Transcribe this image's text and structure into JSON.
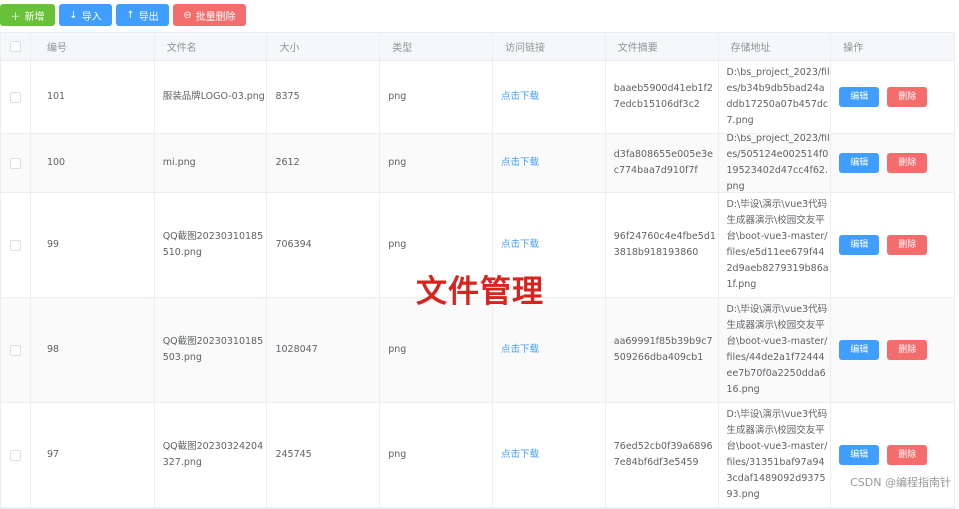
{
  "toolbar": {
    "add_label": "新增",
    "import_label": "导入",
    "export_label": "导出",
    "batch_delete_label": "批量删除"
  },
  "table": {
    "headers": [
      "编号",
      "文件名",
      "大小",
      "类型",
      "访问链接",
      "文件摘要",
      "存储地址",
      "操作"
    ],
    "rows": [
      {
        "id": "101",
        "name": "服装品牌LOGO-03.png",
        "size": "8375",
        "type": "png",
        "link": "点击下载",
        "digest": "baaeb5900d41eb1f27edcb15106df3c2",
        "path": "D:\\bs_project_2023/files/b34b9db5bad24addb17250a07b457dc7.png"
      },
      {
        "id": "100",
        "name": "mi.png",
        "size": "2612",
        "type": "png",
        "link": "点击下载",
        "digest": "d3fa808655e005e3ec774baa7d910f7f",
        "path": "D:\\bs_project_2023/files/505124e002514f019523402d47cc4f62.png"
      },
      {
        "id": "99",
        "name": "QQ截图20230310185510.png",
        "size": "706394",
        "type": "png",
        "link": "点击下载",
        "digest": "96f24760c4e4fbe5d13818b918193860",
        "path": "D:\\毕设\\演示\\vue3代码生成器演示\\校园交友平台\\boot-vue3-master/files/e5d11ee679f442d9aeb8279319b86a1f.png"
      },
      {
        "id": "98",
        "name": "QQ截图20230310185503.png",
        "size": "1028047",
        "type": "png",
        "link": "点击下载",
        "digest": "aa69991f85b39b9c7509266dba409cb1",
        "path": "D:\\毕设\\演示\\vue3代码生成器演示\\校园交友平台\\boot-vue3-master/files/44de2a1f72444ee7b70f0a2250dda616.png"
      },
      {
        "id": "97",
        "name": "QQ截图20230324204327.png",
        "size": "245745",
        "type": "png",
        "link": "点击下载",
        "digest": "76ed52cb0f39a68967e84bf6df3e5459",
        "path": "D:\\毕设\\演示\\vue3代码生成器演示\\校园交友平台\\boot-vue3-master/files/31351baf97a943cdaf1489092d937593.png"
      }
    ],
    "edit_label": "编辑",
    "delete_label": "删除"
  },
  "overlay_title": "文件管理",
  "watermark": "CSDN @编程指南针",
  "colors": {
    "success": "#67c23a",
    "primary": "#409eff",
    "danger": "#f56c6c",
    "overlay": "#d9231d"
  }
}
